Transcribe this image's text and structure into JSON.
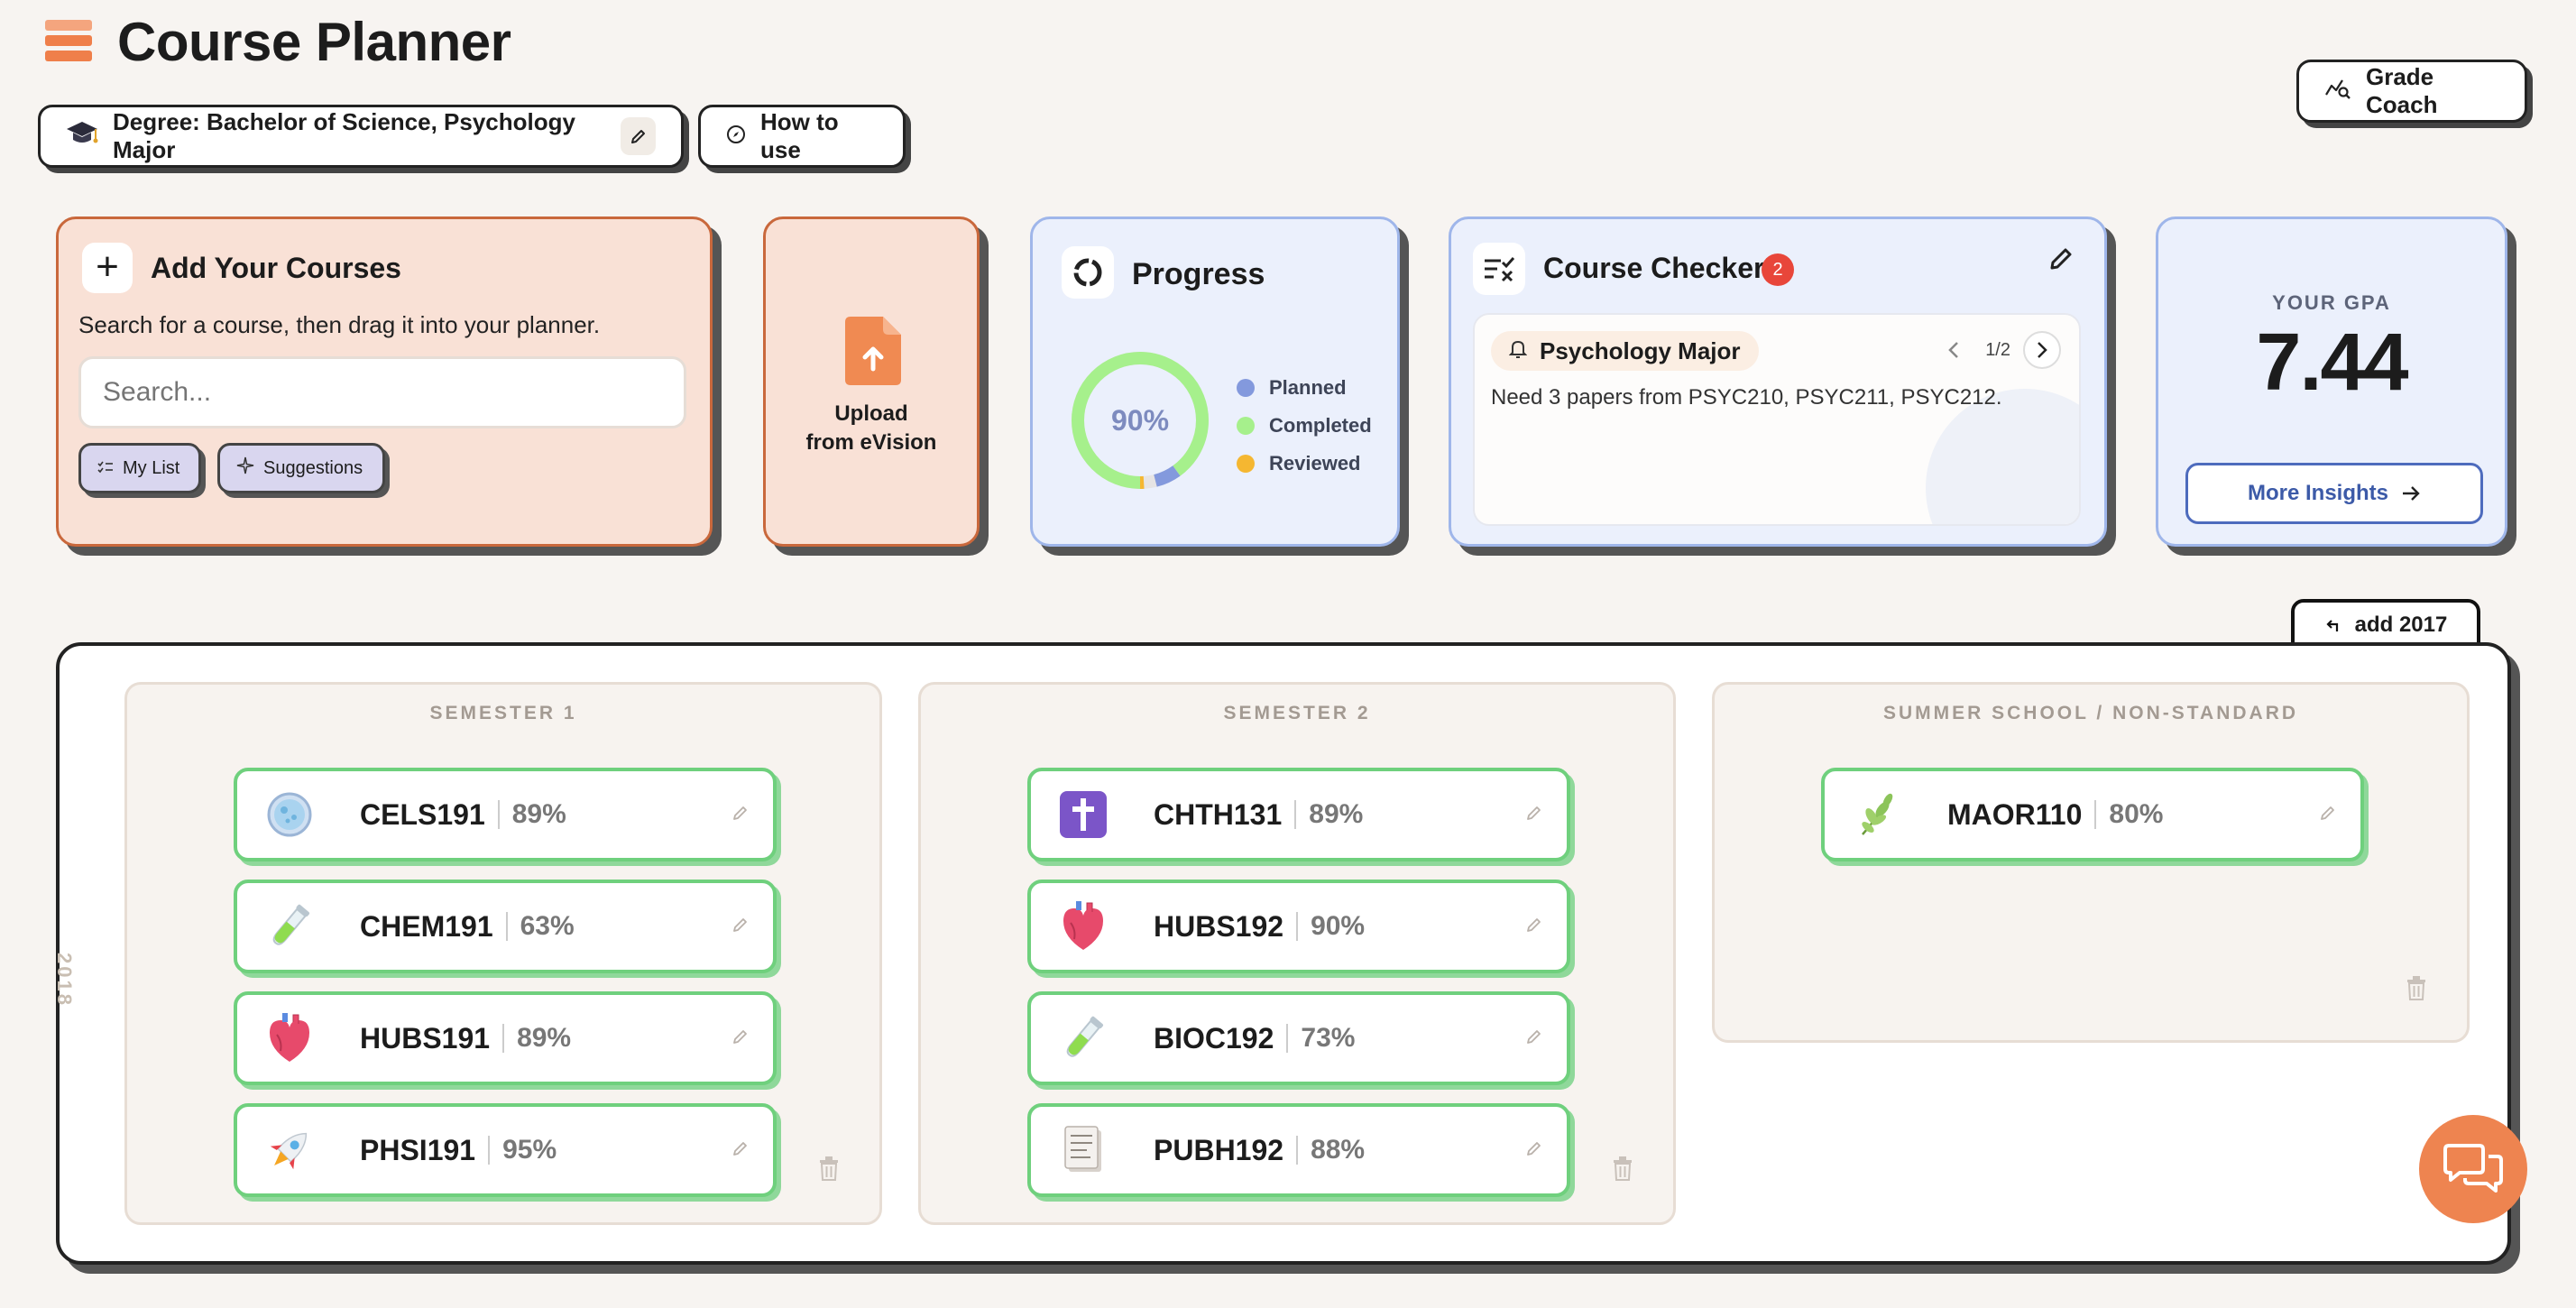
{
  "app": {
    "title": "Course Planner",
    "logo_icon": "app-logo-icon"
  },
  "header": {
    "degree_label": "Degree: Bachelor of Science, Psychology Major",
    "how_to_label": "How to use",
    "grade_coach_label": "Grade Coach"
  },
  "add_courses": {
    "title": "Add Your Courses",
    "subtitle": "Search for a course, then drag it into your planner.",
    "search_placeholder": "Search...",
    "my_list_label": "My List",
    "suggestions_label": "Suggestions"
  },
  "upload": {
    "line1": "Upload",
    "line2": "from eVision"
  },
  "progress": {
    "title": "Progress",
    "percent_label": "90%",
    "percent": 0.9,
    "legend": [
      {
        "label": "Planned",
        "color": "#8399dd"
      },
      {
        "label": "Completed",
        "color": "#a6f08c"
      },
      {
        "label": "Reviewed",
        "color": "#f5b731"
      }
    ]
  },
  "checker": {
    "title": "Course Checker",
    "badge_count": "2",
    "major": "Psychology Major",
    "pager": "1/2",
    "message": "Need 3 papers from PSYC210, PSYC211, PSYC212."
  },
  "gpa": {
    "label": "YOUR GPA",
    "value": "7.44",
    "insights_label": "More Insights"
  },
  "planner": {
    "add_year_label": "add 2017",
    "year_label": "2018",
    "semesters": [
      {
        "title": "SEMESTER 1",
        "courses": [
          {
            "code": "CELS191",
            "grade": "89%",
            "icon": "petri-dish-icon"
          },
          {
            "code": "CHEM191",
            "grade": "63%",
            "icon": "test-tube-icon"
          },
          {
            "code": "HUBS191",
            "grade": "89%",
            "icon": "anatomical-heart-icon"
          },
          {
            "code": "PHSI191",
            "grade": "95%",
            "icon": "rocket-icon"
          }
        ]
      },
      {
        "title": "SEMESTER 2",
        "courses": [
          {
            "code": "CHTH131",
            "grade": "89%",
            "icon": "cross-icon"
          },
          {
            "code": "HUBS192",
            "grade": "90%",
            "icon": "anatomical-heart-icon"
          },
          {
            "code": "BIOC192",
            "grade": "73%",
            "icon": "test-tube-icon"
          },
          {
            "code": "PUBH192",
            "grade": "88%",
            "icon": "document-icon"
          }
        ]
      },
      {
        "title": "SUMMER SCHOOL / NON-STANDARD",
        "courses": [
          {
            "code": "MAOR110",
            "grade": "80%",
            "icon": "herb-icon"
          }
        ]
      }
    ]
  }
}
